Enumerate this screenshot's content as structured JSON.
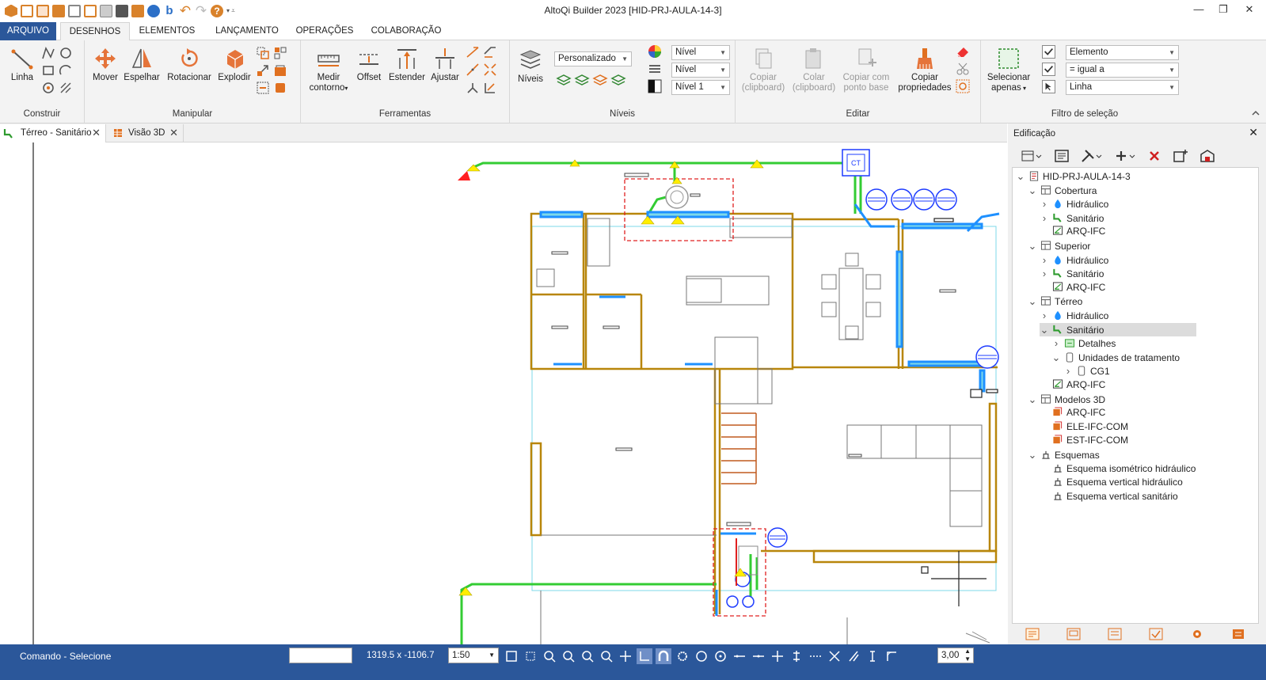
{
  "window": {
    "title": "AltoQi Builder 2023 [HID-PRJ-AULA-14-3]"
  },
  "menu_tabs": [
    "ARQUIVO",
    "DESENHOS",
    "ELEMENTOS",
    "LANÇAMENTO",
    "OPERAÇÕES",
    "COLABORAÇÃO"
  ],
  "ribbon": {
    "construir": {
      "label": "Construir",
      "linha": "Linha"
    },
    "manipular": {
      "label": "Manipular",
      "mover": "Mover",
      "espelhar": "Espelhar",
      "rotacionar": "Rotacionar",
      "explodir": "Explodir"
    },
    "ferramentas": {
      "label": "Ferramentas",
      "medir": "Medir",
      "contorno": "contorno",
      "offset": "Offset",
      "estender": "Estender",
      "ajustar": "Ajustar"
    },
    "niveis": {
      "label": "Níveis",
      "niveis_btn": "Níveis",
      "preset": "Personalizado",
      "combo1": "Nível",
      "combo2": "Nível",
      "combo3": "Nível 1"
    },
    "editar": {
      "label": "Editar",
      "copiar": "Copiar",
      "colar": "Colar",
      "clipboard": "(clipboard)",
      "copiar_com": "Copiar com",
      "ponto_base": "ponto base",
      "copiar_prop": "Copiar",
      "propriedades": "propriedades"
    },
    "filtro": {
      "label": "Filtro de seleção",
      "selecionar": "Selecionar",
      "apenas": "apenas",
      "campo": "Elemento",
      "operador": "= igual a",
      "valor": "Linha"
    }
  },
  "doc_tabs": [
    {
      "label": "Térreo - Sanitário"
    },
    {
      "label": "Visão 3D"
    }
  ],
  "panel": {
    "title": "Edificação",
    "tree": [
      {
        "label": "HID-PRJ-AULA-14-3"
      },
      {
        "label": "Cobertura"
      },
      {
        "label": "Hidráulico"
      },
      {
        "label": "Sanitário"
      },
      {
        "label": "ARQ-IFC"
      },
      {
        "label": "Superior"
      },
      {
        "label": "Hidráulico"
      },
      {
        "label": "Sanitário"
      },
      {
        "label": "ARQ-IFC"
      },
      {
        "label": "Térreo"
      },
      {
        "label": "Hidráulico"
      },
      {
        "label": "Sanitário"
      },
      {
        "label": "Detalhes"
      },
      {
        "label": "Unidades de tratamento"
      },
      {
        "label": "CG1"
      },
      {
        "label": "ARQ-IFC"
      },
      {
        "label": "Modelos 3D"
      },
      {
        "label": "ARQ-IFC"
      },
      {
        "label": "ELE-IFC-COM"
      },
      {
        "label": "EST-IFC-COM"
      },
      {
        "label": "Esquemas"
      },
      {
        "label": "Esquema isométrico hidráulico"
      },
      {
        "label": "Esquema vertical hidráulico"
      },
      {
        "label": "Esquema vertical sanitário"
      }
    ]
  },
  "drawing": {
    "cg_label": "CT"
  },
  "status": {
    "command": "Comando - Selecione",
    "coords": "1319.5 x -1106.7",
    "scale": "1:50",
    "zoom": "3,00"
  },
  "colors": {
    "accent": "#2b579a",
    "wall": "#b8860b",
    "pipe_green": "#33cc33",
    "pipe_blue": "#1e90ff",
    "alert_red": "#e02020"
  }
}
